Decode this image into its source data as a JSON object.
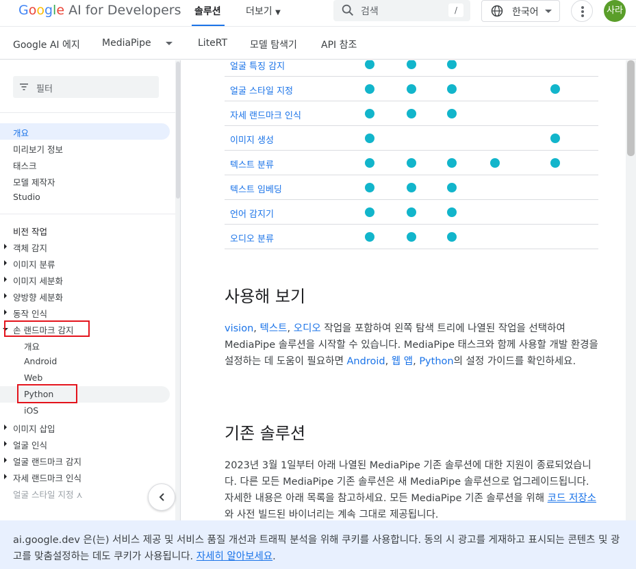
{
  "header": {
    "logo": {
      "g": "G",
      "o1": "o",
      "o2": "o",
      "g2": "g",
      "l": "l",
      "e": "e",
      "rest": " AI for Developers"
    },
    "nav_solutions": "솔루션",
    "nav_more": "더보기",
    "search_placeholder": "검색",
    "search_shortcut": "/",
    "language": "한국어",
    "avatar_initials": "사라"
  },
  "subnav": {
    "items": [
      "Google AI 에지",
      "MediaPipe",
      "LiteRT",
      "모델 탐색기",
      "API 참조"
    ]
  },
  "sidebar": {
    "filter_placeholder": "필터",
    "group1": [
      "개요",
      "미리보기 정보",
      "태스크",
      "모델 제작자",
      "Studio"
    ],
    "group2_heading": "비전 작업",
    "group2": [
      "객체 감지",
      "이미지 분류",
      "이미지 세분화",
      "양방향 세분화",
      "동작 인식",
      "손 랜드마크 감지"
    ],
    "hand_sub": [
      "개요",
      "Android",
      "Web",
      "Python",
      "iOS"
    ],
    "group3": [
      "이미지 삽입",
      "얼굴 인식",
      "얼굴 랜드마크 감지",
      "자세 랜드마크 인식",
      "얼굴 스타일 지정"
    ],
    "fade_suffix": "⋏"
  },
  "table": {
    "rows": [
      {
        "name": "얼굴 특징 감지",
        "cols": [
          1,
          1,
          1,
          0,
          0
        ]
      },
      {
        "name": "얼굴 스타일 지정",
        "cols": [
          1,
          1,
          1,
          0,
          1
        ]
      },
      {
        "name": "자세 랜드마크 인식",
        "cols": [
          1,
          1,
          1,
          0,
          0
        ]
      },
      {
        "name": "이미지 생성",
        "cols": [
          1,
          0,
          0,
          0,
          1
        ]
      },
      {
        "name": "텍스트 분류",
        "cols": [
          1,
          1,
          1,
          1,
          1
        ]
      },
      {
        "name": "텍스트 임베딩",
        "cols": [
          1,
          1,
          1,
          0,
          0
        ]
      },
      {
        "name": "언어 감지기",
        "cols": [
          1,
          1,
          1,
          0,
          0
        ]
      },
      {
        "name": "오디오 분류",
        "cols": [
          1,
          1,
          1,
          0,
          0
        ]
      }
    ]
  },
  "section_try": {
    "heading": "사용해 보기",
    "link_vision": "vision",
    "sep1": ", ",
    "link_text": "텍스트",
    "sep2": ", ",
    "link_audio": "오디오",
    "text1": " 작업을 포함하여 왼쪽 탐색 트리에 나열된 작업을 선택하여 MediaPipe 솔루션을 시작할 수 있습니다. MediaPipe 태스크와 함께 사용할 개발 환경을 설정하는 데 도움이 필요하면 ",
    "link_android": "Android",
    "sep3": ", ",
    "link_web": "웹 앱",
    "sep4": ", ",
    "link_python": "Python",
    "text2": "의 설정 가이드를 확인하세요."
  },
  "section_legacy": {
    "heading": "기존 솔루션",
    "text1": "2023년 3월 1일부터 아래 나열된 MediaPipe 기존 솔루션에 대한 지원이 종료되었습니다. 다른 모든 MediaPipe 기존 솔루션은 새 MediaPipe 솔루션으로 업그레이드됩니다. 자세한 내용은 아래 목록을 참고하세요. 모든 MediaPipe 기존 솔루션을 위해 ",
    "link_code": "코드 저장소",
    "text2": "와 사전 빌드된 바이너리는 계속 그대로 제공됩니다."
  },
  "cookie": {
    "text": "ai.google.dev 은(는) 서비스 제공 및 서비스 품질 개선과 트래픽 분석을 위해 쿠키를 사용합니다. 동의 시 광고를 게재하고 표시되는 콘텐츠 및 광고를 맞춤설정하는 데도 쿠키가 사용됩니다. ",
    "link": "자세히 알아보세요",
    "end": "."
  },
  "colors": {
    "accent": "#1a73e8",
    "dot": "#12b5cb",
    "highlight": "#e3121b"
  }
}
